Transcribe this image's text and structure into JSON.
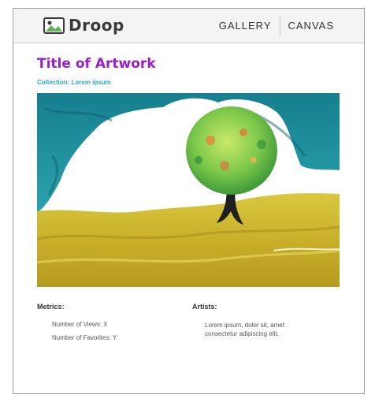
{
  "header": {
    "logo_text": "Droop",
    "logo_icon": "image-landscape-icon",
    "nav": [
      {
        "label": "GALLERY"
      },
      {
        "label": "CANVAS"
      }
    ]
  },
  "artwork": {
    "title": "Title of Artwork",
    "collection": "Collection: Lorem ipsum"
  },
  "metrics": {
    "heading": "Metrics:",
    "views": "Number of Views: X",
    "favorites": "Number of Favorites: Y"
  },
  "artists": {
    "heading": "Artists:",
    "text": "Lorem ipsum, dolor sit, amet consectetur adipiscing elit."
  },
  "colors": {
    "title": "#9b1ec8",
    "collection": "#2aa6c9",
    "sky": "#1f8e9c",
    "hills": "#cbb52a"
  }
}
